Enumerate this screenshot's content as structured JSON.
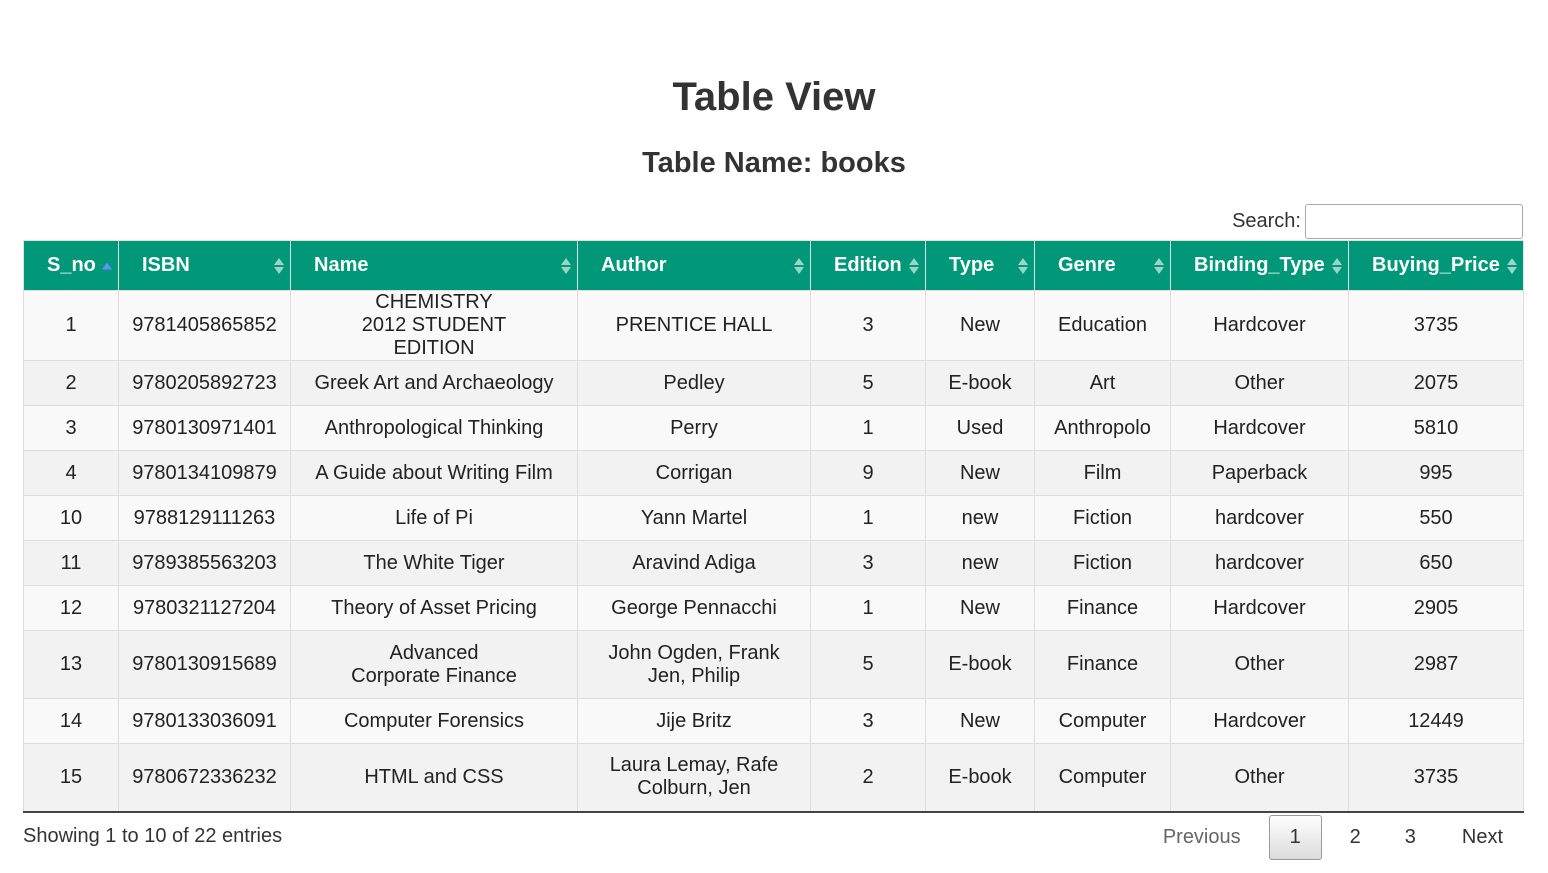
{
  "page": {
    "title": "Table View",
    "table_name": "Table Name: books"
  },
  "search": {
    "label": "Search:",
    "value": "",
    "placeholder": ""
  },
  "table": {
    "columns": [
      "S_no",
      "ISBN",
      "Name",
      "Author",
      "Edition",
      "Type",
      "Genre",
      "Binding_Type",
      "Buying_Price"
    ],
    "rows": [
      [
        "1",
        "9781405865852",
        "CHEMISTRY 2012 STUDENT EDITION",
        "PRENTICE HALL",
        "3",
        "New",
        "Education",
        "Hardcover",
        "3735"
      ],
      [
        "2",
        "9780205892723",
        "Greek Art and Archaeology",
        "Pedley",
        "5",
        "E-book",
        "Art",
        "Other",
        "2075"
      ],
      [
        "3",
        "9780130971401",
        "Anthropological Thinking",
        "Perry",
        "1",
        "Used",
        "Anthropolo",
        "Hardcover",
        "5810"
      ],
      [
        "4",
        "9780134109879",
        "A Guide about Writing Film",
        "Corrigan",
        "9",
        "New",
        "Film",
        "Paperback",
        "995"
      ],
      [
        "10",
        "9788129111263",
        "Life of Pi",
        "Yann Martel",
        "1",
        "new",
        "Fiction",
        "hardcover",
        "550"
      ],
      [
        "11",
        "9789385563203",
        "The White Tiger",
        "Aravind Adiga",
        "3",
        "new",
        "Fiction",
        "hardcover",
        "650"
      ],
      [
        "12",
        "9780321127204",
        "Theory of Asset Pricing",
        "George Pennacchi",
        "1",
        "New",
        "Finance",
        "Hardcover",
        "2905"
      ],
      [
        "13",
        "9780130915689",
        "Advanced Corporate Finance",
        "John Ogden, Frank Jen, Philip",
        "5",
        "E-book",
        "Finance",
        "Other",
        "2987"
      ],
      [
        "14",
        "9780133036091",
        "Computer Forensics",
        "Jije Britz",
        "3",
        "New",
        "Computer",
        "Hardcover",
        "12449"
      ],
      [
        "15",
        "9780672336232",
        "HTML and CSS",
        "Laura Lemay, Rafe Colburn, Jen",
        "2",
        "E-book",
        "Computer",
        "Other",
        "3735"
      ]
    ],
    "sorted_column": "S_no",
    "sort_direction": "ascending"
  },
  "footer": {
    "info": "Showing 1 to 10 of 22 entries",
    "pagination": {
      "previous": "Previous",
      "pages": [
        "1",
        "2",
        "3"
      ],
      "current_page": "1",
      "next": "Next"
    }
  },
  "colors": {
    "header_bg": "#009879",
    "header_text": "#ffffff",
    "sort_active": "#6b8cff"
  }
}
